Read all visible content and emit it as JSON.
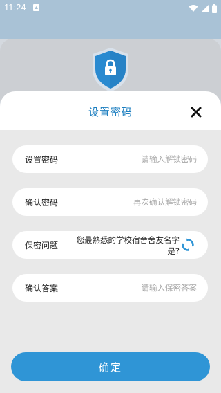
{
  "status_bar": {
    "time": "11:24"
  },
  "dialog": {
    "title": "设置密码",
    "close_icon": "close-icon"
  },
  "fields": {
    "set_password": {
      "label": "设置密码",
      "placeholder": "请输入解锁密码"
    },
    "confirm_password": {
      "label": "确认密码",
      "placeholder": "再次确认解锁密码"
    },
    "security_question": {
      "label": "保密问题",
      "question": "您最熟悉的学校宿舍舍友名字是?"
    },
    "confirm_answer": {
      "label": "确认答案",
      "placeholder": "请输入保密答案"
    }
  },
  "confirm_button": {
    "label": "确定"
  },
  "colors": {
    "accent": "#2f95d6",
    "title_blue": "#1d7fc0",
    "status_bar": "#a9c2d6",
    "shield_blue": "#2a8ad0"
  }
}
